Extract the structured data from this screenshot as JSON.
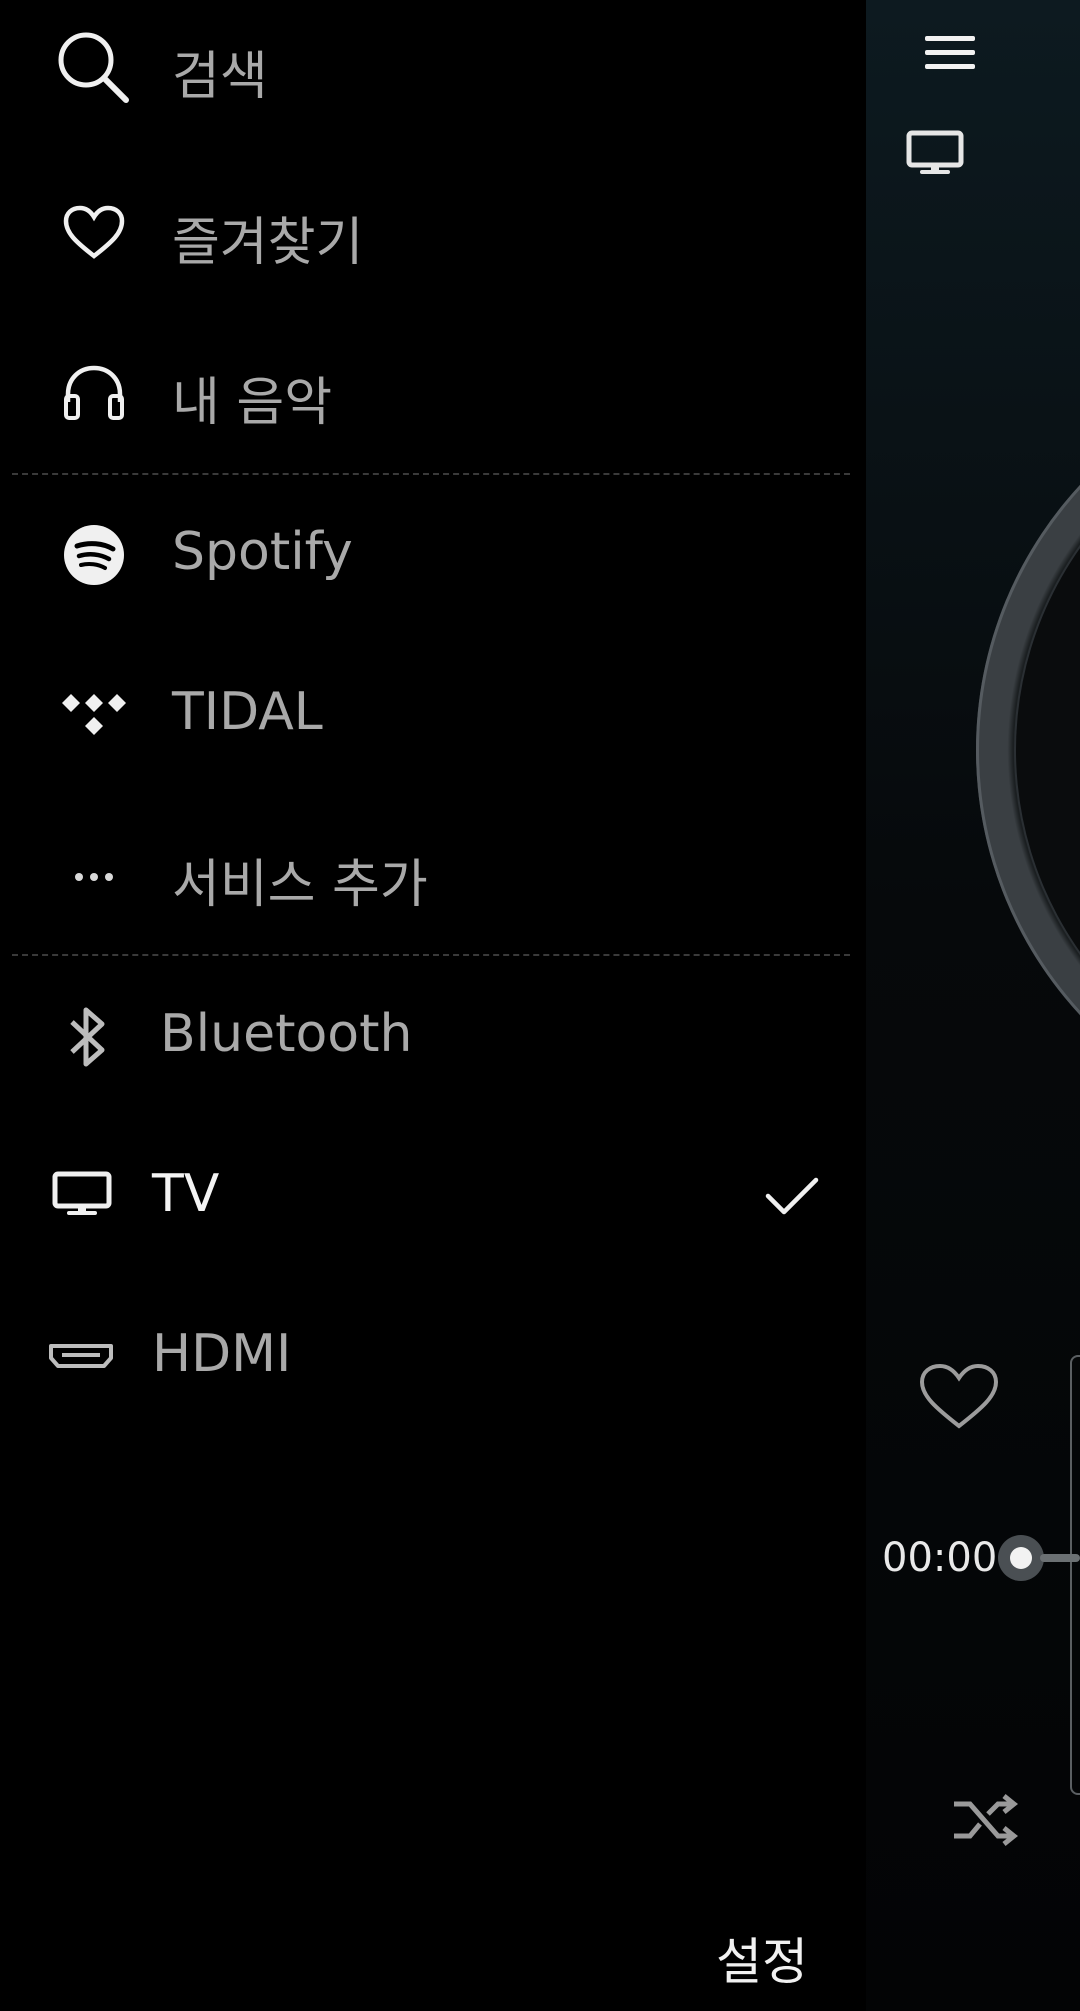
{
  "drawer": {
    "items": [
      {
        "label": "검색",
        "icon": "search-icon"
      },
      {
        "label": "즐겨찾기",
        "icon": "heart-icon"
      },
      {
        "label": "내 음악",
        "icon": "headphones-icon"
      },
      {
        "label": "Spotify",
        "icon": "spotify-icon"
      },
      {
        "label": "TIDAL",
        "icon": "tidal-icon"
      },
      {
        "label": "서비스 추가",
        "icon": "more-icon"
      },
      {
        "label": "Bluetooth",
        "icon": "bluetooth-icon"
      },
      {
        "label": "TV",
        "icon": "tv-icon",
        "selected": true
      },
      {
        "label": "HDMI",
        "icon": "hdmi-icon"
      }
    ],
    "settings_label": "설정"
  },
  "player": {
    "elapsed": "00:00",
    "progress": 0
  },
  "colors": {
    "drawer_bg": "#000000",
    "label_inactive": "#a9a9a9",
    "label_active": "#f4f4f4",
    "divider": "#3a3a3a"
  }
}
